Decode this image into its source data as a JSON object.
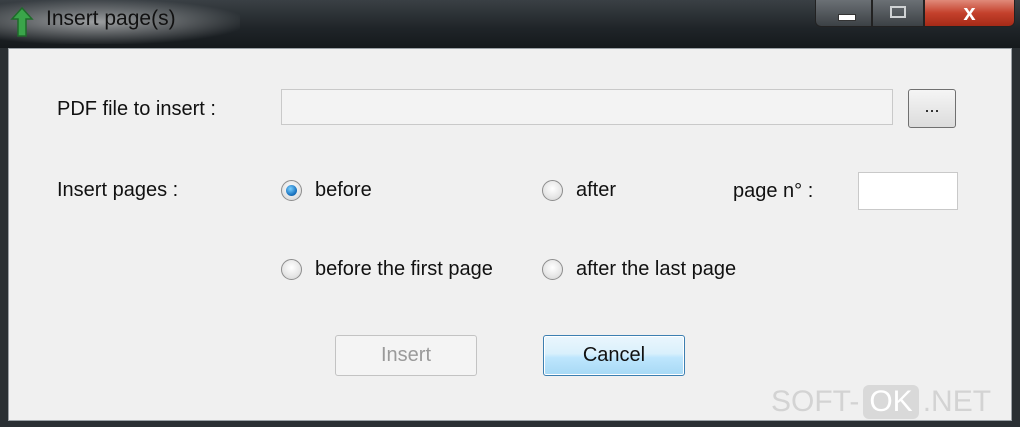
{
  "window": {
    "title": "Insert page(s)",
    "close_glyph": "x",
    "icon": "green-arrow-app-icon"
  },
  "form": {
    "pdf_label": "PDF file to insert :",
    "pdf_value": "",
    "browse_label": "...",
    "insert_pages_label": "Insert pages :",
    "page_no_label": "page n° :",
    "page_no_value": "",
    "options": [
      {
        "label": "before",
        "checked": true
      },
      {
        "label": "after",
        "checked": false
      },
      {
        "label": "before the first page",
        "checked": false
      },
      {
        "label": "after the last page",
        "checked": false
      }
    ]
  },
  "buttons": {
    "insert_label": "Insert",
    "insert_enabled": false,
    "cancel_label": "Cancel"
  },
  "watermark": {
    "prefix": "SOFT-",
    "boxed": "OK",
    "suffix": ".NET"
  },
  "colors": {
    "accent": "#3c7fb1",
    "close": "#c4412c"
  }
}
